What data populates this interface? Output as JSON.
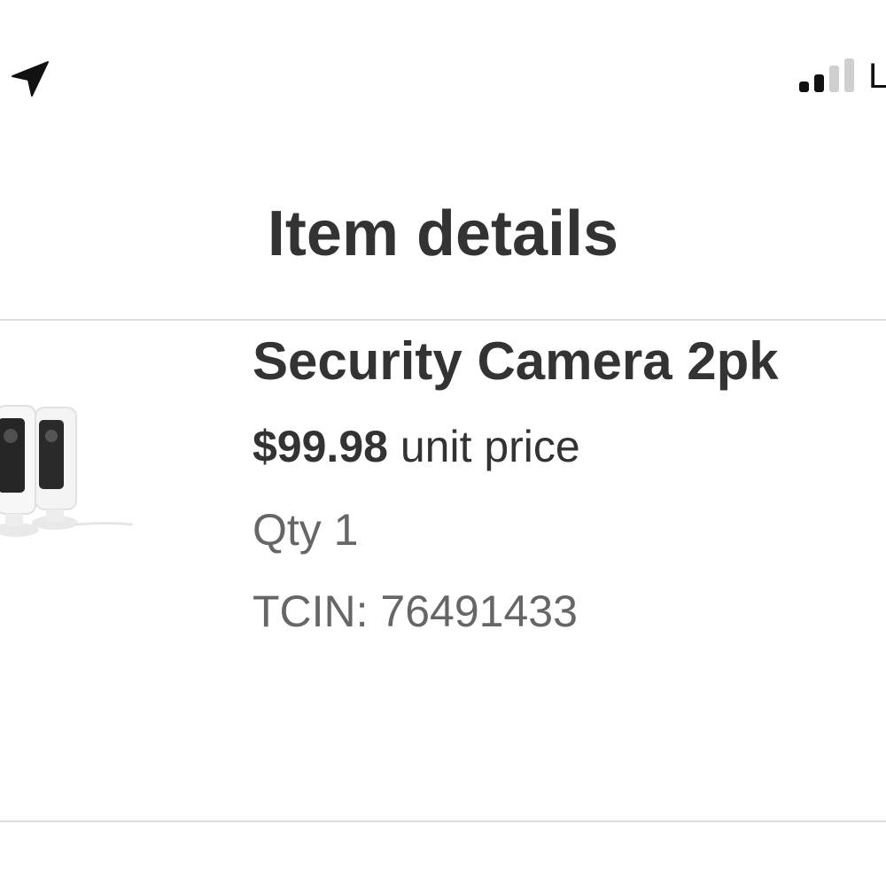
{
  "status_bar": {
    "location_icon": "location-arrow-icon",
    "signal_icon": "cellular-signal-icon",
    "signal_bars_active": 2,
    "signal_bars_total": 4,
    "carrier_text": "L"
  },
  "header": {
    "title": "Item details"
  },
  "item": {
    "image_icon": "security-camera-image",
    "name": "Security Camera 2pk",
    "price": "$99.98",
    "price_suffix": "unit price",
    "qty": "Qty 1",
    "tcin": "TCIN: 76491433"
  },
  "colors": {
    "text_primary": "#333333",
    "text_secondary": "#666666",
    "divider": "#dcdcdc",
    "background": "#ffffff"
  }
}
